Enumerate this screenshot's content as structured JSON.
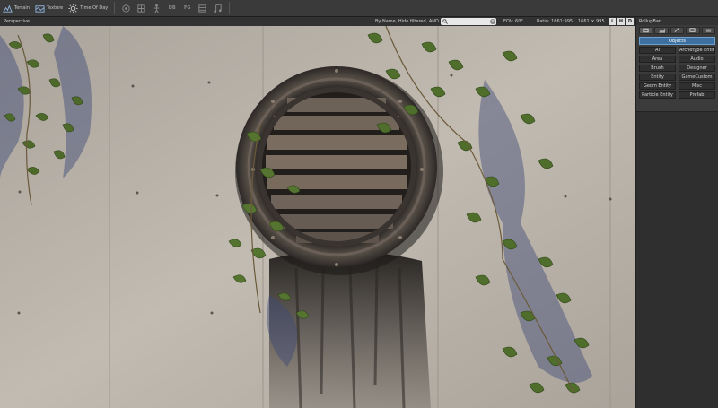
{
  "toolbar": {
    "terrain_label": "Terrain",
    "texture_label": "Texture",
    "time_of_day_label": "Time Of Day",
    "icons": [
      "terrain-icon",
      "texture-icon",
      "sun-icon",
      "ai-icon",
      "grid-icon",
      "figure-icon",
      "db-icon",
      "fg-icon",
      "layers-icon",
      "music-icon"
    ],
    "db_label": "DB",
    "fg_label": "FG"
  },
  "viewport": {
    "title": "Perspective",
    "filter_text": "By Name, Hide filtered, AND",
    "search_value": "",
    "fov": "FOV:    60°",
    "ratio": "Ratio: 1661:995",
    "resolution": "1661 × 995",
    "btn_info": "i",
    "btn_h": "H",
    "btn_d": "D"
  },
  "rollupbar": {
    "title": "RollupBar",
    "tabs": [
      "objects-tab",
      "terrain-tab",
      "modelling-tab",
      "display-tab",
      "layers-tab"
    ],
    "objects_header": "Objects",
    "buttons": [
      [
        "AI",
        "Archetype Entity"
      ],
      [
        "Area",
        "Audio"
      ],
      [
        "Brush",
        "Designer"
      ],
      [
        "Entity",
        "GameCustom"
      ],
      [
        "Geom Entity",
        "Misc"
      ],
      [
        "Particle Entity",
        "Prefab"
      ]
    ]
  },
  "colors": {
    "accent": "#3d6fa0",
    "wall": "#b7b0a7",
    "metal": "#3a3532",
    "ivy": "#4d6a2a"
  }
}
